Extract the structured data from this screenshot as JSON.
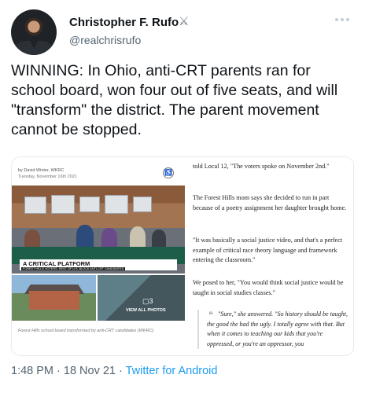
{
  "author": {
    "name": "Christopher F. Rufo",
    "badge_glyph": "⚔",
    "handle": "@realchrisrufo"
  },
  "tweet": {
    "text": "WINNING: In Ohio, anti-CRT parents ran for school board, won four out of five seats, and will \"transform\" the district. The parent movement cannot be stopped."
  },
  "article": {
    "byline": "by David Winter, WKRC",
    "date": "Tuesday, November 16th 2021",
    "banner_title": "A CRITICAL PLATFORM",
    "banner_subtitle": "FOREST HILLS VOTERS, REST OF U.S. BLOCK ANTI-CRT CANDIDATES",
    "photos_icon": "▢3",
    "photos_label": "VIEW ALL PHOTOS",
    "caption": "Forest Hills school board transformed by anti-CRT candidates (WKRC)",
    "paragraphs": [
      "told Local 12, \"The voters spoke on November 2nd.\"",
      "The Forest Hills mom says she decided to run in part because of a poetry assignment her daughter brought home.",
      "\"It was basically a social justice video, and that's a perfect example of critical race theory language and framework entering the classroom.\"",
      "We posed to her, \"You would think social justice would be taught in social studies classes.\""
    ],
    "quote": "\"Sure,\" she answered. \"So history should be taught, the good the bad the ugly. I totally agree with that. But when it comes to teaching our kids that you're oppressed, or you're an oppressor, you"
  },
  "meta": {
    "time_date": "1:48 PM · 18 Nov 21 · ",
    "source": "Twitter for Android"
  }
}
